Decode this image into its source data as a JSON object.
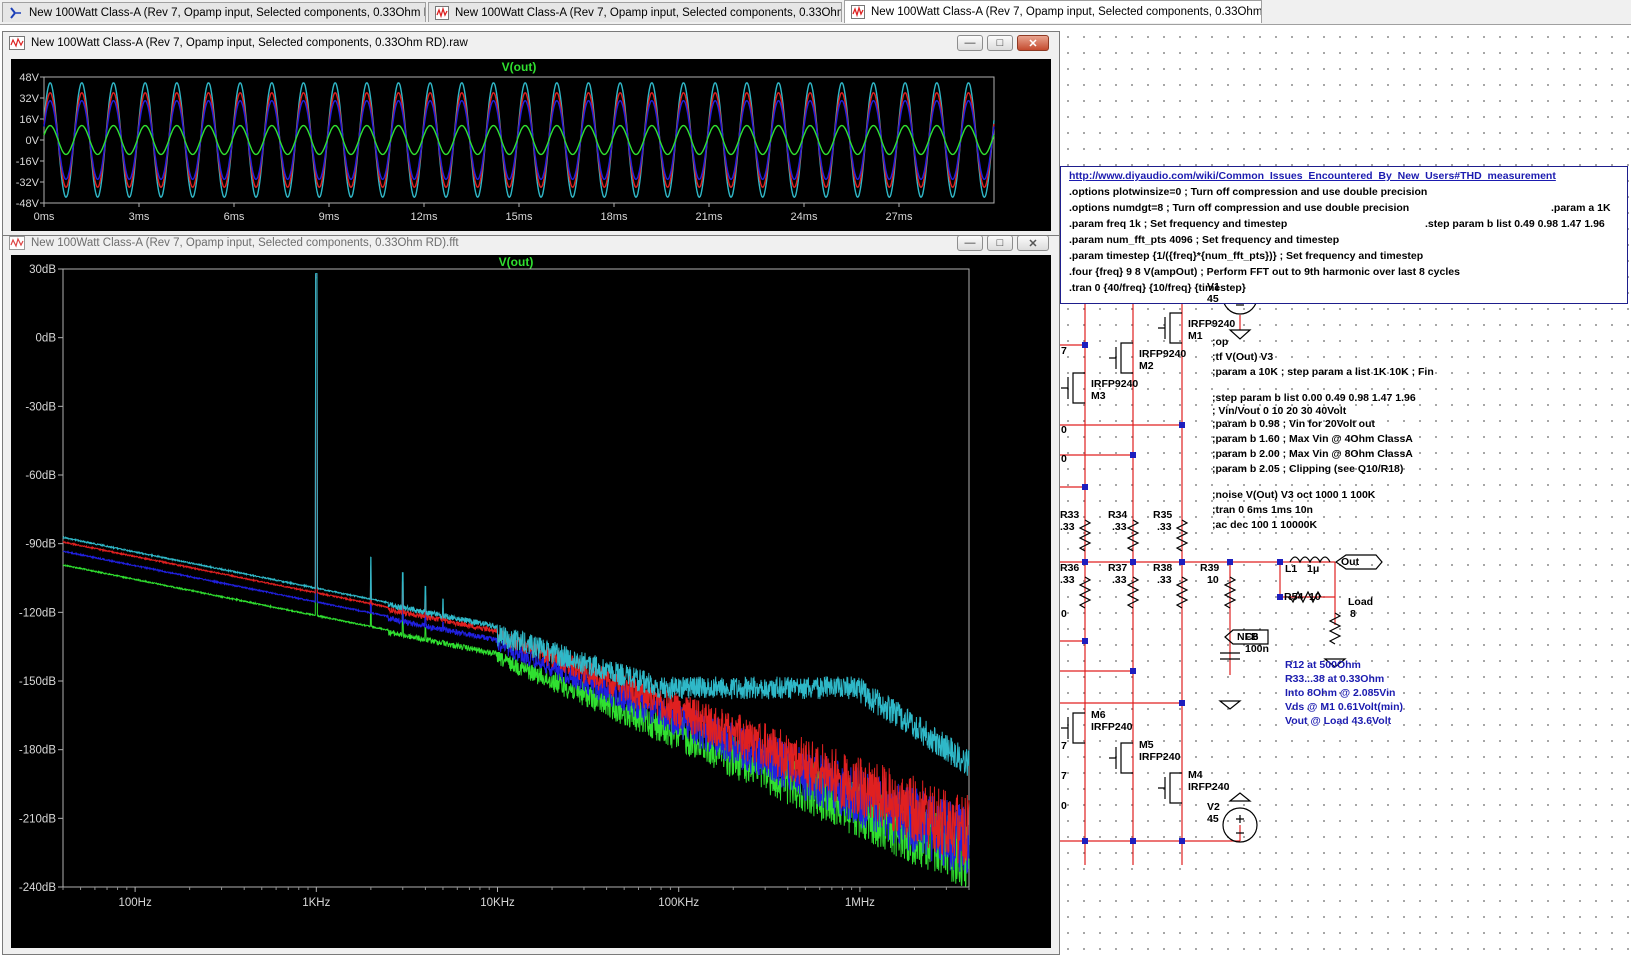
{
  "tabs": [
    {
      "label": "New 100Watt Class-A (Rev 7, Opamp input, Selected components, 0.33Ohm RD).asc",
      "icon": "schematic-icon",
      "active": false
    },
    {
      "label": "New 100Watt Class-A (Rev 7, Opamp input, Selected components, 0.33Ohm RD).fft",
      "icon": "waveform-icon",
      "active": false
    },
    {
      "label": "New 100Watt Class-A (Rev 7, Opamp input, Selected components, 0.33Ohm RD).raw",
      "icon": "waveform-icon",
      "active": true
    }
  ],
  "windows": {
    "raw": {
      "title": "New 100Watt Class-A (Rev 7, Opamp input, Selected components, 0.33Ohm RD).raw",
      "minimize": "—",
      "restore": "□",
      "close": "✕"
    },
    "fft": {
      "title": "New 100Watt Class-A (Rev 7, Opamp input, Selected components, 0.33Ohm RD).fft",
      "minimize": "—",
      "restore": "□",
      "close": "✕"
    }
  },
  "chart_data": [
    {
      "type": "line",
      "title": "V(out)",
      "xlabel": "",
      "ylabel": "",
      "x_ticks": [
        "0ms",
        "3ms",
        "6ms",
        "9ms",
        "12ms",
        "15ms",
        "18ms",
        "21ms",
        "24ms",
        "27ms"
      ],
      "y_ticks": [
        "48V",
        "32V",
        "16V",
        "0V",
        "-16V",
        "-32V",
        "-48V"
      ],
      "xlim": [
        0,
        30
      ],
      "ylim": [
        -48,
        48
      ],
      "grid": false,
      "x_unit": "ms",
      "frequency_khz": 1,
      "series": [
        {
          "color": "#2fb8c8",
          "amplitude": 43.6
        },
        {
          "color": "#e02020",
          "amplitude": 36
        },
        {
          "color": "#2020e0",
          "amplitude": 30
        },
        {
          "color": "#30e030",
          "amplitude": 11
        }
      ]
    },
    {
      "type": "line",
      "title": "V(out)",
      "xlabel": "",
      "ylabel": "",
      "x_scale": "log",
      "x_ticks": [
        "100Hz",
        "1KHz",
        "10KHz",
        "100KHz",
        "1MHz"
      ],
      "x_tick_values": [
        100,
        1000,
        10000,
        100000,
        1000000
      ],
      "y_ticks": [
        "30dB",
        "0dB",
        "-30dB",
        "-60dB",
        "-90dB",
        "-120dB",
        "-150dB",
        "-180dB",
        "-210dB",
        "-240dB"
      ],
      "y_tick_values": [
        30,
        0,
        -30,
        -60,
        -90,
        -120,
        -150,
        -180,
        -210,
        -240
      ],
      "xlim": [
        40,
        4000000
      ],
      "ylim": [
        -240,
        30
      ],
      "grid": false,
      "fundamental_hz": 1000,
      "fundamental_db": 28,
      "series": [
        {
          "color": "#2fb8c8",
          "floor_db_at_40hz": -87,
          "floor_db_at_10khz": -125,
          "noise_plateau_db": -148,
          "knee_hz": 1000000,
          "end_db": -180
        },
        {
          "color": "#e02020",
          "floor_db_at_40hz": -89,
          "floor_db_at_10khz": -127,
          "noise_plateau_db": null,
          "end_db": -200
        },
        {
          "color": "#2020e0",
          "floor_db_at_40hz": -93,
          "floor_db_at_10khz": -131,
          "noise_plateau_db": null,
          "end_db": -205
        },
        {
          "color": "#30e030",
          "floor_db_at_40hz": -99,
          "floor_db_at_10khz": -137,
          "noise_plateau_db": null,
          "end_db": -210
        }
      ]
    }
  ],
  "schematic": {
    "directives": [
      "http://www.diyaudio.com/wiki/Common_Issues_Encountered_By_New_Users#THD_measurement",
      ".options plotwinsize=0 ; Turn off compression and use double precision",
      ".options numdgt=8 ; Turn off compression and use double precision",
      ".param freq 1k ; Set frequency and timestep",
      ".param num_fft_pts 4096 ; Set frequency and timestep",
      ".param timestep {1/({freq}*{num_fft_pts})} ; Set frequency and timestep",
      ".four {freq} 9 8 V(ampOut) ; Perform FFT out to 9th harmonic over last 8 cycles",
      ".tran 0 {40/freq} {10/freq} {timestep}"
    ],
    "directive_right_1": ".param a 1K",
    "directive_right_2": ".step param b list 0.49 0.98 1.47 1.96",
    "comments": [
      ";op",
      ";tf V(Out) V3",
      ";param a 10K ; step param a list 1K 10K ; Fin",
      ";step param b list 0.00 0.49 0.98 1.47 1.96",
      "; Vin/Vout 0 10 20 30 40Volt",
      ";param b 0.98 ; Vin for 20Volt out",
      ";param b 1.60 ; Max Vin @ 4Ohm ClassA",
      ";param b 2.00 ; Max Vin @ 8Ohm ClassA",
      ";param b 2.05 ; Clipping (see Q10/R18)",
      ";noise V(Out) V3 oct 1000 1 100K",
      ";tran 0 6ms 1ms 10n",
      ";ac dec 100 1 10000K"
    ],
    "notes": [
      "R12 at 500Ohm",
      "R33...38 at 0.33Ohm",
      "Into 8Ohm @ 2.085Vin",
      "Vds @ M1 0.61Volt(min)",
      "Vout @ Load 43.6Volt"
    ],
    "labels": {
      "v1": "V1",
      "v1_val": "45",
      "v2": "V2",
      "v2_val": "45",
      "m1": "M1",
      "m2": "M2",
      "m3": "M3",
      "m4": "M4",
      "m5": "M5",
      "m6": "M6",
      "p_fet": "IRFP9240",
      "n_fet": "IRFP240",
      "r33": "R33",
      "r34": "R34",
      "r35": "R35",
      "r36": "R36",
      "r37": "R37",
      "r38": "R38",
      "r_val": ".33",
      "r39": "R39",
      "r39_val": "10",
      "r54": "R54",
      "r54_val": "10",
      "l1": "L1",
      "l1_val": "1μ",
      "c6": "C6",
      "c6_val": "100n",
      "load": "Load",
      "load_val": "8",
      "out": "Out",
      "nfb": "NFB",
      "left_digits": [
        "7",
        "0",
        "0",
        "0",
        "7",
        "7",
        "0"
      ]
    },
    "colors": {
      "wire": "#e02020",
      "node": "#1e1ebe",
      "component": "#000000",
      "note": "#1b1bb0"
    }
  }
}
